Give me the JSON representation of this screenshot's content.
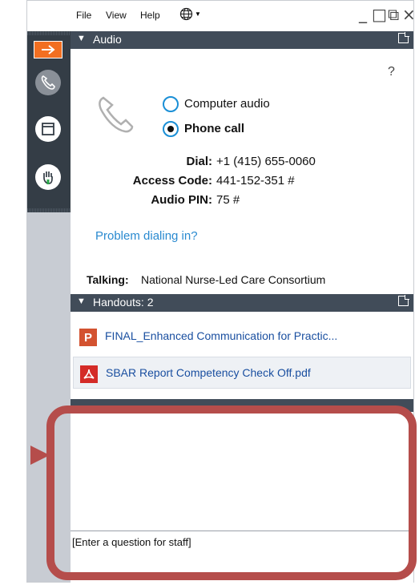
{
  "menubar": {
    "file": "File",
    "view": "View",
    "help": "Help",
    "globe_icon": "globe-icon"
  },
  "window_controls": {
    "minimize": "_",
    "maximize": "□",
    "restore": "⧉",
    "close": "×"
  },
  "rail": {
    "items": [
      {
        "name": "rail-collapse-arrow",
        "icon": "arrow-right-icon",
        "active": true,
        "color": "#f26f21"
      },
      {
        "name": "rail-phone-button",
        "icon": "phone-icon"
      },
      {
        "name": "rail-window-button",
        "icon": "window-icon"
      },
      {
        "name": "rail-raise-hand-button",
        "icon": "raise-hand-icon",
        "accent": "#2aa84a"
      }
    ]
  },
  "audio": {
    "header": "Audio",
    "help": "?",
    "options": [
      {
        "label": "Computer audio",
        "selected": false
      },
      {
        "label": "Phone call",
        "selected": true
      }
    ],
    "dial_label": "Dial:",
    "dial_value": "+1 (415) 655-0060",
    "access_label": "Access Code:",
    "access_value": "441-152-351 #",
    "pin_label": "Audio PIN:",
    "pin_value": "75 #",
    "problem_link": "Problem dialing in?",
    "talking_label": "Talking:",
    "talking_value": "National Nurse-Led Care Consortium"
  },
  "handouts": {
    "header": "Handouts: 2",
    "items": [
      {
        "name": "FINAL_Enhanced Communication for Practic...",
        "type": "P",
        "color": "#d35230"
      },
      {
        "name": "SBAR Report Competency Check Off.pdf",
        "type": "pdf",
        "color": "#d42b27"
      }
    ]
  },
  "questions": {
    "placeholder": "[Enter a question for staff]"
  },
  "callout_color": "#b54d4b"
}
